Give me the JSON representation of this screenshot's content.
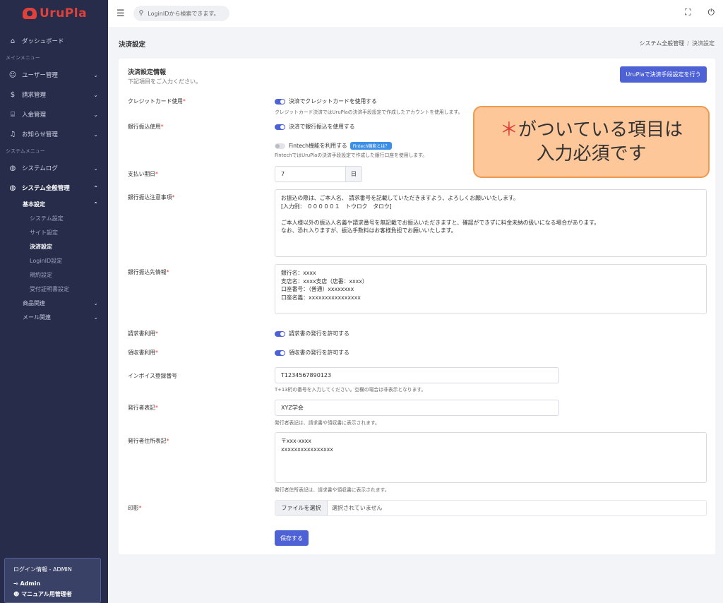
{
  "app": {
    "logo_text": "UruPla"
  },
  "topbar": {
    "search_placeholder": "LoginIDから検索できます。"
  },
  "sidebar": {
    "dashboard": "ダッシュボード",
    "section_main": "メインメニュー",
    "users": "ユーザー管理",
    "billing": "請求管理",
    "payments": "入金管理",
    "notices": "お知らせ管理",
    "section_system": "システムメニュー",
    "syslog": "システムログ",
    "sysall": "システム全般管理",
    "basic": "基本設定",
    "sub": [
      "システム設定",
      "サイト設定",
      "決済設定",
      "LoginID設定",
      "規約設定",
      "受付証明書設定"
    ],
    "products": "商品関連",
    "mail": "メール関連",
    "login_title": "ログイン情報 - ADMIN",
    "login_user": "Admin",
    "login_role": "マニュアル用管理者"
  },
  "page": {
    "title": "決済設定",
    "breadcrumb_parent": "システム全般管理",
    "breadcrumb_sep": "/",
    "breadcrumb_current": "決済設定"
  },
  "card": {
    "title": "決済設定情報",
    "subtitle": "下記項目をご入力ください。",
    "fintech_button": "UruPlaで決済手段設定を行う"
  },
  "form": {
    "req": "*",
    "credit_label": "クレジットカード使用",
    "credit_toggle": "決済でクレジットカードを使用する",
    "credit_help": "クレジットカード決済ではUruPlaの決済手段設定で作成したアカウントを使用します。",
    "bank_label": "銀行振込使用",
    "bank_toggle": "決済で銀行振込を使用する",
    "fintech_toggle": "Fintech機能を利用する",
    "fintech_badge": "Fintech機能とは？",
    "fintech_help": "FintechではUruPlaの決済手段設定で作成した銀行口座を使用します。",
    "due_label": "支払い期日",
    "due_value": "7",
    "due_unit": "日",
    "bank_notice_label": "銀行振込注意事項",
    "bank_notice_value": "お振込の際は、ご本人名、 請求番号を記載していただきますよう、よろしくお願いいたします。\n[入力例： ０００００１　トウロク　タロウ]\n\nご本人様以外の振込人名義や請求番号を無記載でお振込いただきますと、確認ができずに料金未納の扱いになる場合があります。\nなお、恐れ入りますが、振込手数料はお客様負担でお願いいたします。",
    "bank_info_label": "銀行振込先情報",
    "bank_info_value": "銀行名：xxxx\n支店名：xxxx支店（店番：xxxx）\n口座番号：（普通）xxxxxxxx\n口座名義：xxxxxxxxxxxxxxxx",
    "invoice_label": "請求書利用",
    "invoice_toggle": "請求書の発行を許可する",
    "receipt_label": "領収書利用",
    "receipt_toggle": "領収書の発行を許可する",
    "reg_label": "インボイス登録番号",
    "reg_value": "T1234567890123",
    "reg_help": "T+13桁の番号を入力してください。空欄の場合は非表示となります。",
    "issuer_label": "発行者表記",
    "issuer_value": "XYZ学会",
    "issuer_help": "発行者表記は、請求書や領収書に表示されます。",
    "addr_label": "発行者住所表記",
    "addr_value": "〒xxx-xxxx\nxxxxxxxxxxxxxxxx",
    "addr_help": "発行者住所表記は、請求書や領収書に表示されます。",
    "seal_label": "印影",
    "file_button": "ファイルを選択",
    "file_status": "選択されていません",
    "save_button": "保存する"
  },
  "callout": {
    "star": "＊",
    "line1": "がついている項目は",
    "line2": "入力必須です"
  }
}
